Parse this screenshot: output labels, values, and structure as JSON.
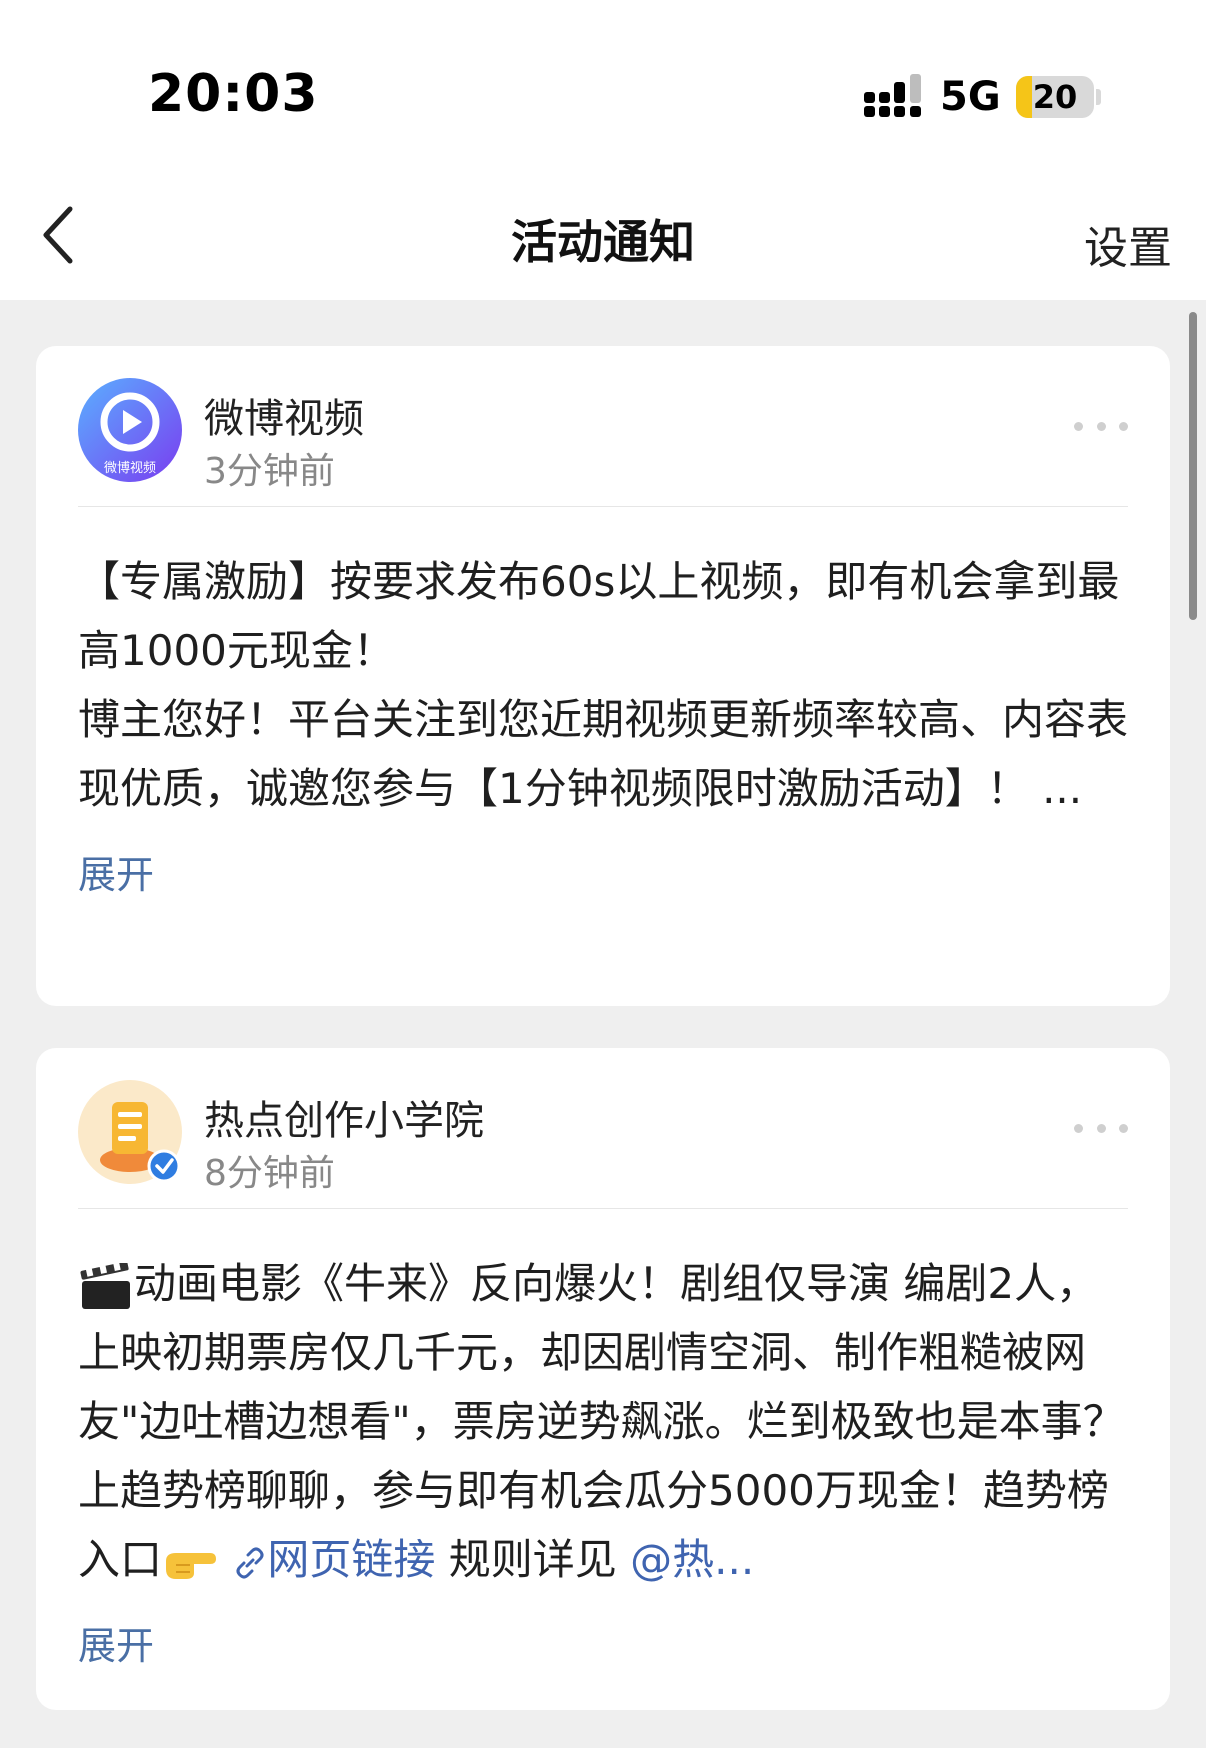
{
  "status_bar": {
    "time": "20:03",
    "network": "5G",
    "battery": "20",
    "battery_level_percent": 20,
    "battery_color": "#f5c518"
  },
  "nav": {
    "back_icon": "chevron-left-icon",
    "title": "活动通知",
    "settings_label": "设置"
  },
  "notifications": [
    {
      "sender": "微博视频",
      "time": "3分钟前",
      "avatar_label": "微博视频",
      "title": "【专属激励】按要求发布60s以上视频，即有机会拿到最高1000元现金！",
      "body": "博主您好！平台关注到您近期视频更新频率较高、内容表现优质，诚邀您参与【1分钟视频限时激励活动】！ ...",
      "expand_label": "展开"
    },
    {
      "sender": "热点创作小学院",
      "time": "8分钟前",
      "verified": true,
      "body_start": "动画电影《牛来》反向爆火！剧组仅导演 编剧2人，上映初期票房仅几千元，却因剧情空洞、制作粗糙被网友\"边吐槽边想看\"，票房逆势飙涨。烂到极致也是本事？上趋势榜聊聊，参与即有机会瓜分5000万现金！趋势榜入口",
      "link_text": "网页链接",
      "rules_text": "规则详见",
      "mention_text": "@热...",
      "expand_label": "展开"
    }
  ],
  "colors": {
    "link": "#3f64b0",
    "expand": "#4a6fa5",
    "background": "#efefef"
  }
}
